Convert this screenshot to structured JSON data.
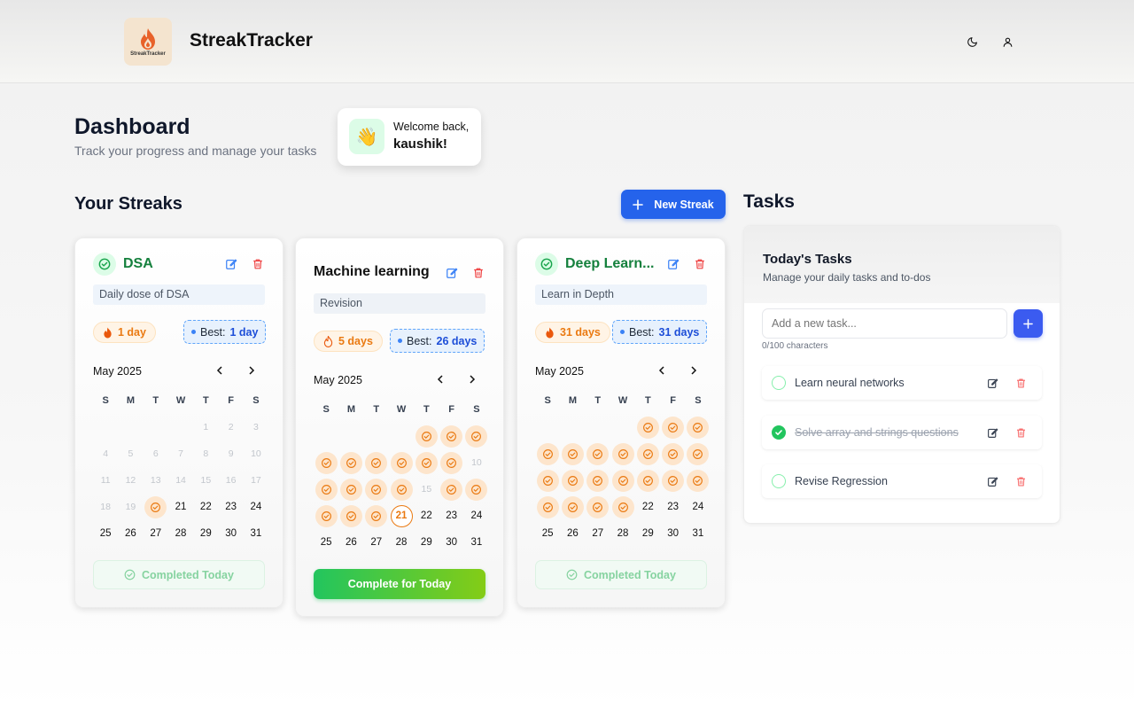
{
  "app": {
    "title": "StreakTracker",
    "logo_caption": "StreakTracker"
  },
  "header": {
    "theme_icon": "moon-icon",
    "user_icon": "user-icon"
  },
  "dashboard": {
    "title": "Dashboard",
    "subtitle": "Track your progress and manage your tasks"
  },
  "welcome": {
    "line1": "Welcome back,",
    "username": "kaushik!",
    "emoji": "👋"
  },
  "streaks": {
    "title": "Your Streaks",
    "new_button": "New Streak",
    "best_label": "Best:",
    "dow": [
      "S",
      "M",
      "T",
      "W",
      "T",
      "F",
      "S"
    ],
    "cards": [
      {
        "name": "DSA",
        "description": "Daily dose of DSA",
        "current": "1 day",
        "best": "1 day",
        "month": "May 2025",
        "action": "Completed Today",
        "completed": true
      },
      {
        "name": "Machine learning",
        "description": "Revision",
        "current": "5 days",
        "best": "26 days",
        "month": "May 2025",
        "action": "Complete for Today",
        "completed": false
      },
      {
        "name": "Deep Learn...",
        "description": "Learn in Depth",
        "current": "31 days",
        "best": "31 days",
        "month": "May 2025",
        "action": "Completed Today",
        "completed": true
      }
    ]
  },
  "tasks": {
    "section_title": "Tasks",
    "panel_title": "Today's Tasks",
    "panel_subtitle": "Manage your daily tasks and to-dos",
    "input_placeholder": "Add a new task...",
    "char_count": "0/100 characters",
    "items": [
      {
        "text": "Learn neural networks",
        "done": false
      },
      {
        "text": "Solve array and strings questions",
        "done": true
      },
      {
        "text": "Revise Regression",
        "done": false
      }
    ]
  },
  "colors": {
    "accent": "#2563eb",
    "streak_orange": "#ea7a12",
    "success": "#22c55e",
    "danger": "#ef4444"
  }
}
